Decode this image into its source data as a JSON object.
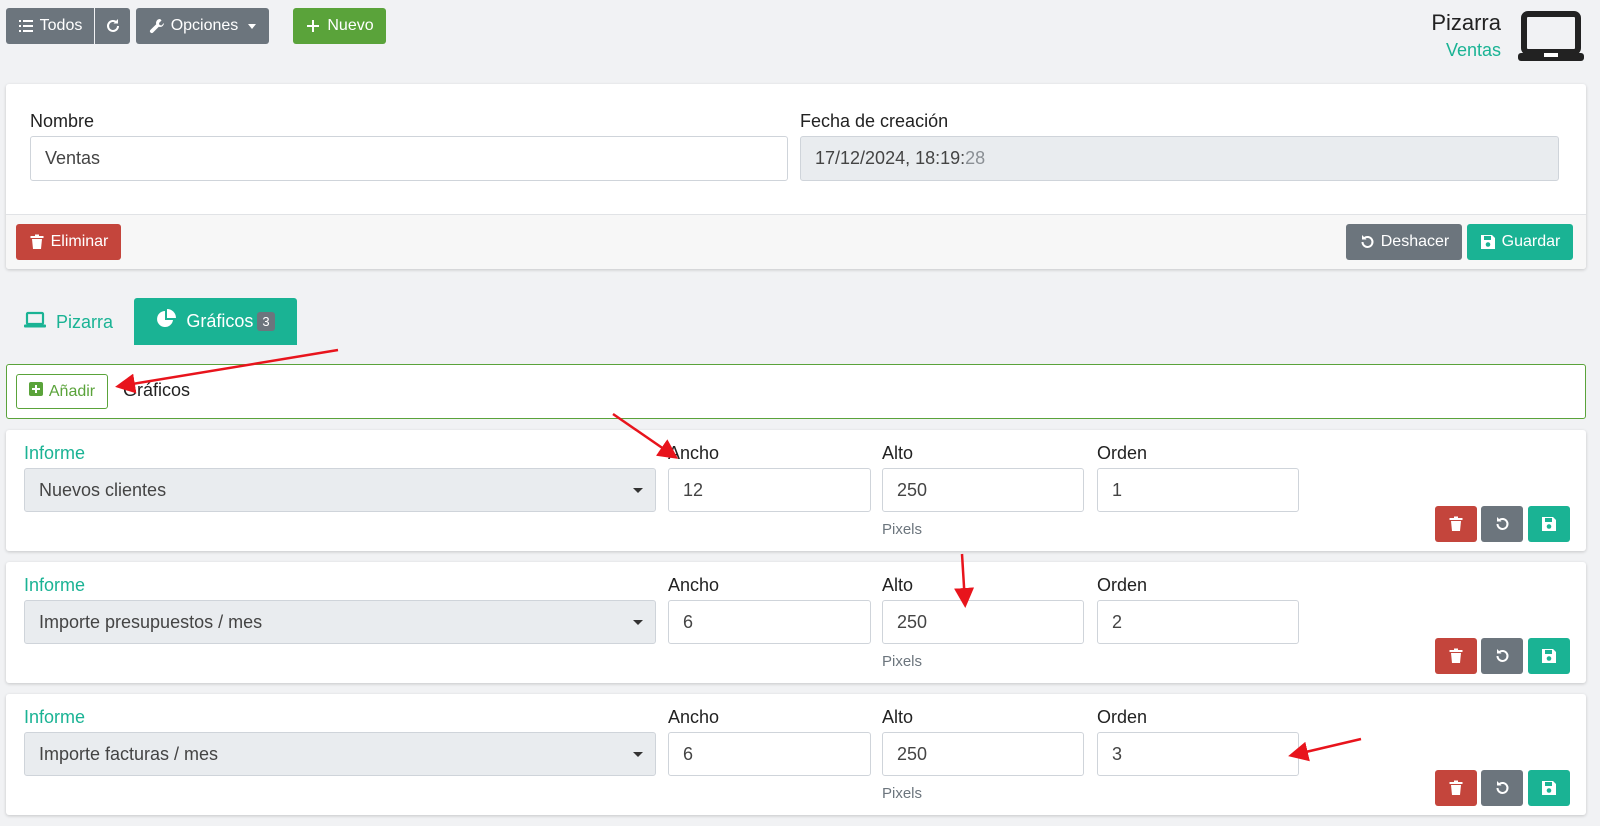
{
  "toolbar": {
    "todos_label": "Todos",
    "opciones_label": "Opciones",
    "nuevo_label": "Nuevo"
  },
  "header": {
    "title": "Pizarra",
    "subtitle": "Ventas"
  },
  "form": {
    "nombre_label": "Nombre",
    "nombre_value": "Ventas",
    "fecha_label": "Fecha de creación",
    "fecha_value_main": "17/12/2024, 18:19:",
    "fecha_value_seconds": "28",
    "eliminar_label": "Eliminar",
    "deshacer_label": "Deshacer",
    "guardar_label": "Guardar"
  },
  "tabs": [
    {
      "label": "Pizarra",
      "active": false
    },
    {
      "label": "Gráficos",
      "badge": "3",
      "active": true
    }
  ],
  "charts_panel": {
    "add_label": "Añadir",
    "title": "Gráficos"
  },
  "rows": [
    {
      "informe_label": "Informe",
      "informe_value": "Nuevos clientes",
      "ancho_label": "Ancho",
      "ancho_value": "12",
      "alto_label": "Alto",
      "alto_value": "250",
      "alto_hint": "Pixels",
      "orden_label": "Orden",
      "orden_value": "1"
    },
    {
      "informe_label": "Informe",
      "informe_value": "Importe presupuestos / mes",
      "ancho_label": "Ancho",
      "ancho_value": "6",
      "alto_label": "Alto",
      "alto_value": "250",
      "alto_hint": "Pixels",
      "orden_label": "Orden",
      "orden_value": "2"
    },
    {
      "informe_label": "Informe",
      "informe_value": "Importe facturas / mes",
      "ancho_label": "Ancho",
      "ancho_value": "6",
      "alto_label": "Alto",
      "alto_value": "250",
      "alto_hint": "Pixels",
      "orden_label": "Orden",
      "orden_value": "3"
    }
  ],
  "colors": {
    "accent": "#1ab394",
    "green": "#5aa33a",
    "danger": "#c4453c",
    "secondary": "#6c757d",
    "annotation": "#e8141c"
  },
  "icons": [
    "list-icon",
    "refresh-icon",
    "wrench-icon",
    "plus-icon",
    "laptop-icon",
    "trash-icon",
    "undo-icon",
    "save-icon",
    "pie-chart-icon",
    "plus-square-icon"
  ]
}
